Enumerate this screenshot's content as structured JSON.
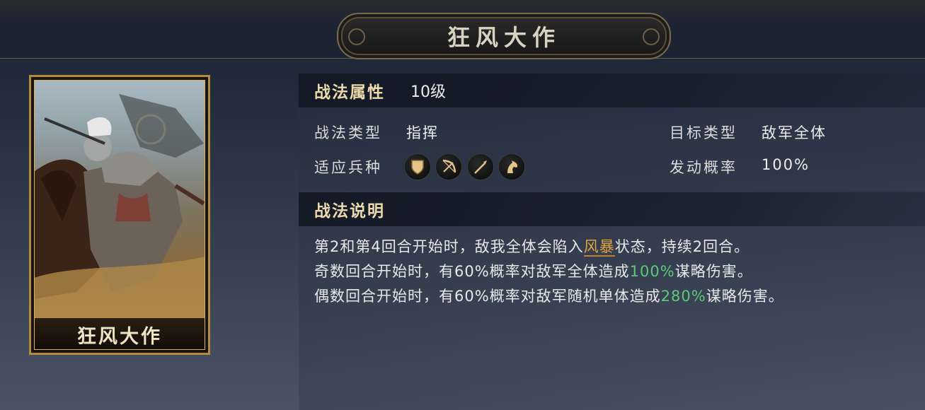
{
  "header": {
    "title": "狂风大作"
  },
  "card": {
    "name": "狂风大作"
  },
  "attributes": {
    "section_title": "战法属性",
    "level": "10级",
    "type_label": "战法类型",
    "type_value": "指挥",
    "target_label": "目标类型",
    "target_value": "敌军全体",
    "troops_label": "适应兵种",
    "troops": [
      "shield-icon",
      "bow-icon",
      "spear-icon",
      "horse-icon"
    ],
    "chance_label": "发动概率",
    "chance_value": "100%"
  },
  "description": {
    "section_title": "战法说明",
    "line1": {
      "a": "第2和第4回合开始时，敌我全体会陷入",
      "keyword": "风暴",
      "b": "状态，持续2回合。"
    },
    "line2": {
      "a": "奇数回合开始时，有60%概率对敌军全体造成",
      "value": "100%",
      "b": "谋略伤害。"
    },
    "line3": {
      "a": "偶数回合开始时，有60%概率对敌军随机单体造成",
      "value": "280%",
      "b": "谋略伤害。"
    }
  },
  "colors": {
    "accent_gold": "#ecd9ac",
    "keyword": "#e3a53f",
    "value_green": "#5fc877",
    "card_border": "#b48a3e"
  }
}
